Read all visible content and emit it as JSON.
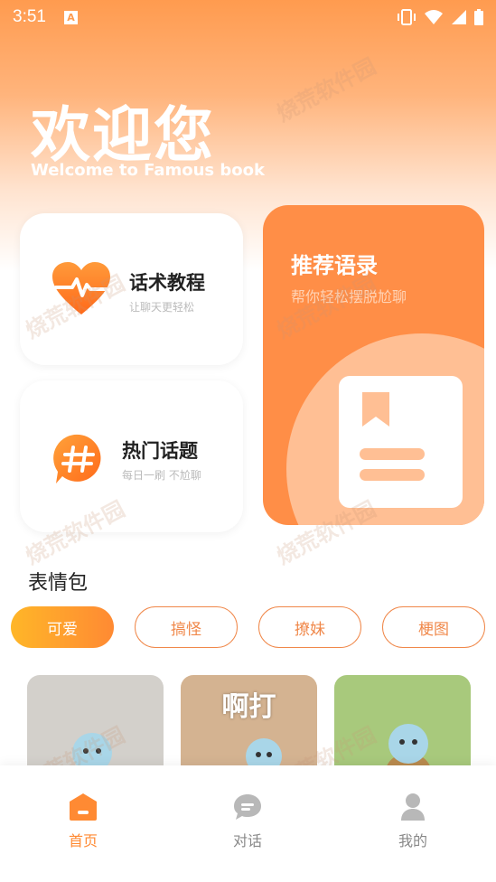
{
  "status_bar": {
    "time": "3:51",
    "badge": "A"
  },
  "hero": {
    "title": "欢迎您",
    "subtitle": "Welcome to Famous book"
  },
  "cards": {
    "script": {
      "title": "话术教程",
      "subtitle": "让聊天更轻松",
      "icon": "heart-pulse-icon"
    },
    "topics": {
      "title": "热门话题",
      "subtitle": "每日一刷 不尬聊",
      "icon": "hashtag-chat-icon"
    },
    "quotes": {
      "title": "推荐语录",
      "subtitle": "帮你轻松摆脱尬聊",
      "icon": "bookmark-document-icon"
    }
  },
  "emoji_section": {
    "title": "表情包"
  },
  "chips": [
    {
      "label": "可爱",
      "active": true
    },
    {
      "label": "搞怪",
      "active": false
    },
    {
      "label": "撩妹",
      "active": false
    },
    {
      "label": "梗图",
      "active": false
    }
  ],
  "thumbnails": [
    {
      "caption": ""
    },
    {
      "caption": "啊打"
    },
    {
      "caption": ""
    }
  ],
  "tabbar": [
    {
      "label": "首页",
      "icon": "home-icon",
      "active": true
    },
    {
      "label": "对话",
      "icon": "chat-bubble-icon",
      "active": false
    },
    {
      "label": "我的",
      "icon": "person-icon",
      "active": false
    }
  ],
  "watermark": "烧荒软件园",
  "colors": {
    "accent": "#ff8a33",
    "card_big": "#ff8e47",
    "chip_border": "#f0884a"
  }
}
